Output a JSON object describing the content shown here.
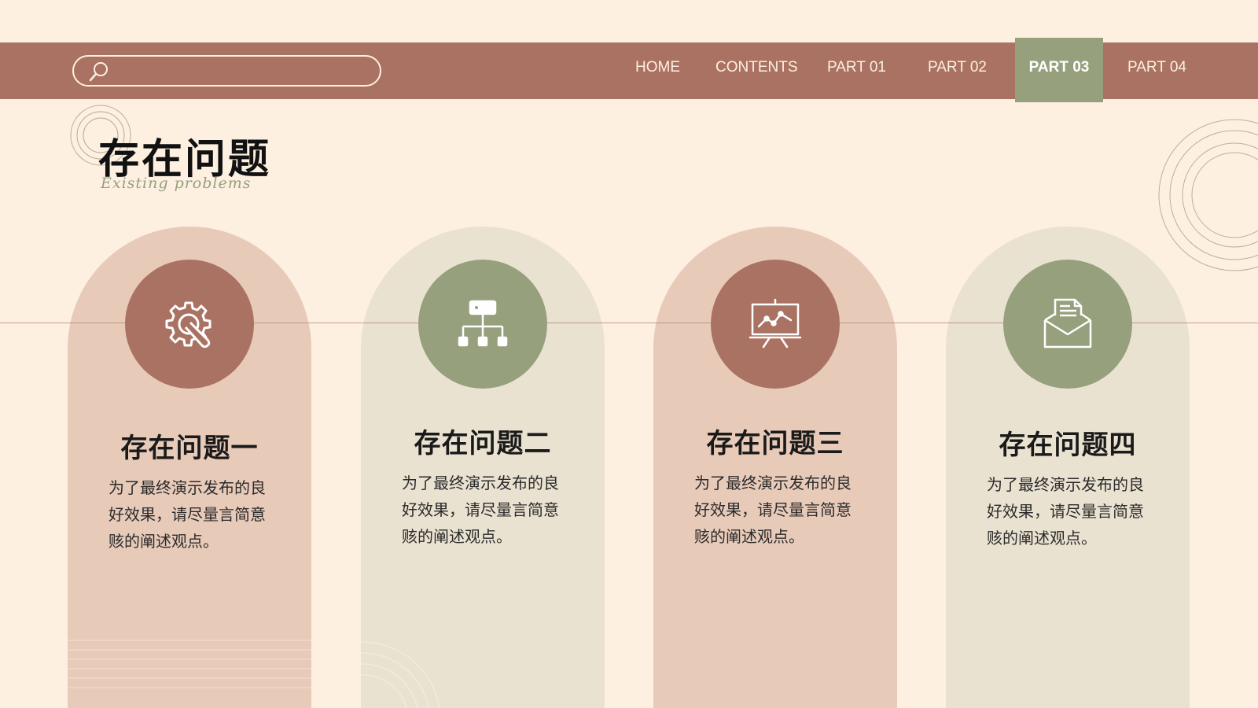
{
  "search": {
    "placeholder": "",
    "value": ""
  },
  "nav": {
    "items": [
      "HOME",
      "CONTENTS",
      "PART 01",
      "PART 02",
      "PART 03",
      "PART 04"
    ],
    "active": "PART 03"
  },
  "header": {
    "title": "存在问题",
    "subtitle": "Existing problems"
  },
  "cards": [
    {
      "title": "存在问题一",
      "body": "为了最终演示发布的良好效果，请尽量言简意赅的阐述观点。",
      "icon": "gear-wrench-icon",
      "color": "#aa7262"
    },
    {
      "title": "存在问题二",
      "body": "为了最终演示发布的良好效果，请尽量言简意赅的阐述观点。",
      "icon": "hierarchy-icon",
      "color": "#96a07d"
    },
    {
      "title": "存在问题三",
      "body": "为了最终演示发布的良好效果，请尽量言简意赅的阐述观点。",
      "icon": "presentation-chart-icon",
      "color": "#aa7262"
    },
    {
      "title": "存在问题四",
      "body": "为了最终演示发布的良好效果，请尽量言简意赅的阐述观点。",
      "icon": "envelope-document-icon",
      "color": "#96a07d"
    }
  ],
  "colors": {
    "background": "#fdf0e1",
    "navbar": "#aa7262",
    "active_tab": "#96a07d",
    "card_pink": "#e8cab9",
    "card_beige": "#eae2d1"
  }
}
